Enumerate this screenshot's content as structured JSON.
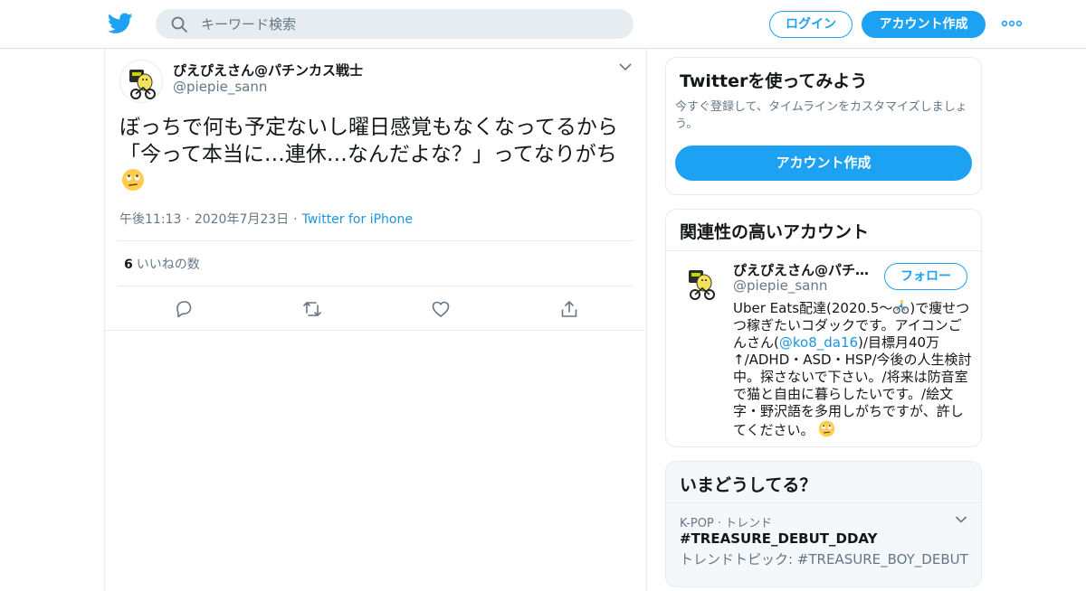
{
  "header": {
    "search_placeholder": "キーワード検索",
    "login_label": "ログイン",
    "signup_label": "アカウント作成",
    "brand_color": "#1da1f2"
  },
  "tweet": {
    "author_name": "ぴえぴえさん@パチンカス戦士",
    "author_handle": "@piepie_sann",
    "text": "ぼっちで何も予定ないし曜日感覚もなくなってるから「今って本当に…連休…なんだよな？」ってなりがち",
    "time": "午後11:13",
    "date": "2020年7月23日",
    "source": "Twitter for iPhone",
    "like_count": "6",
    "like_label": "いいねの数",
    "icons": [
      "reply-icon",
      "retweet-icon",
      "like-icon",
      "share-icon"
    ]
  },
  "sidebar": {
    "signup_card": {
      "title": "Twitterを使ってみよう",
      "description": "今すぐ登録して、タイムラインをカスタマイズしましょう。",
      "button_label": "アカウント作成"
    },
    "related_card": {
      "title": "関連性の高いアカウント",
      "account_name": "ぴえぴえさん@パチンカス戦士",
      "account_handle": "@piepie_sann",
      "follow_label": "フォロー",
      "bio_part1": "Uber Eats配達(2020.5〜",
      "bio_part2": ")で痩せつつ稼ぎたいコダックです。アイコンごんさん(",
      "bio_mention": "@ko8_da16",
      "bio_part3": ")/目標月40万↑/ADHD・ASD・HSP/今後の人生検討中。探さないで下さい。/将来は防音室で猫と自由に暮らしたいです。/絵文字・野沢語を多用しがちですが、許してください。"
    },
    "trends_card": {
      "title": "いまどうしてる？",
      "trend_category": "K-POP · トレンド",
      "trend_tag": "#TREASURE_DEBUT_DDAY",
      "trend_topic": "トレンドトピック: #TREASURE_BOY_DEBUT"
    }
  }
}
